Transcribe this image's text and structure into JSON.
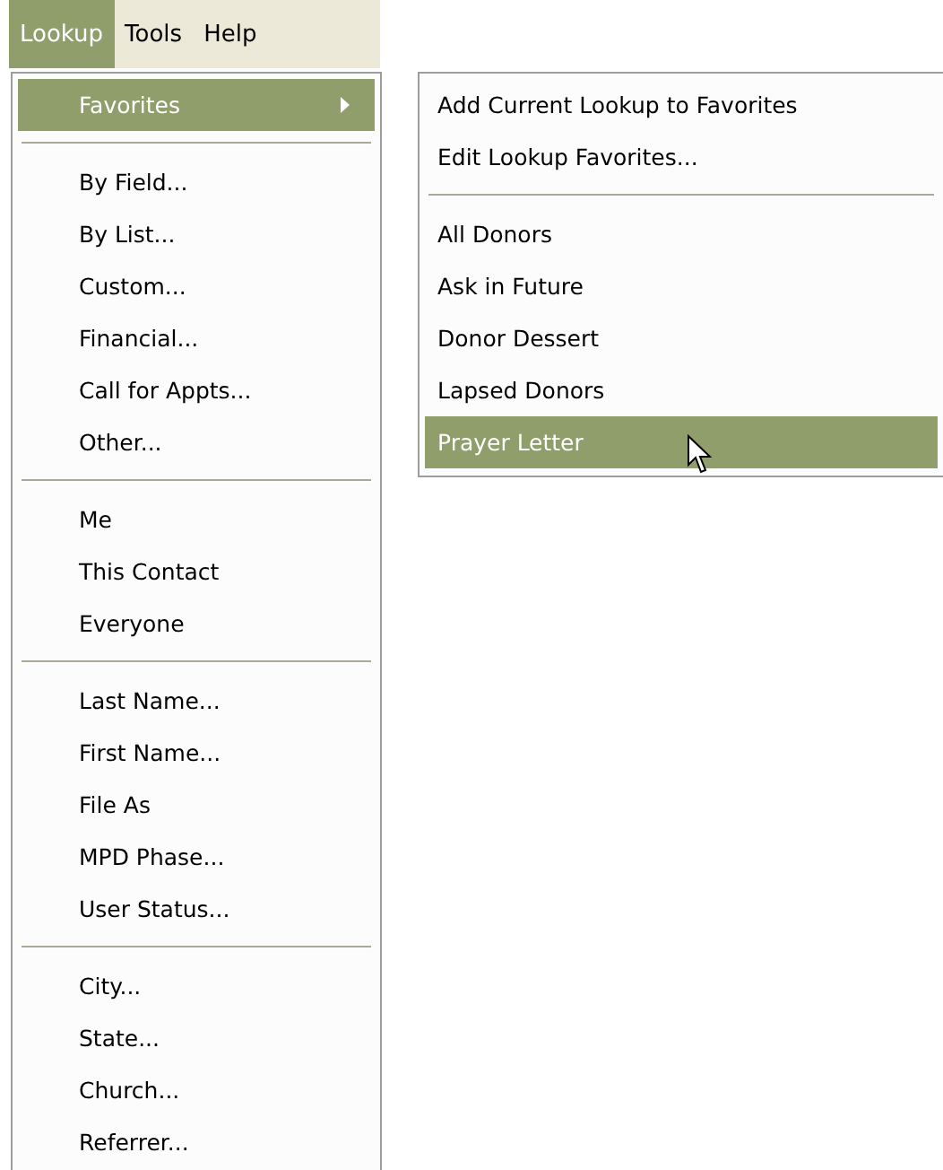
{
  "menu_bar": [
    {
      "label": "Lookup",
      "selected": true
    },
    {
      "label": "Tools",
      "selected": false
    },
    {
      "label": "Help",
      "selected": false
    }
  ],
  "lookup_menu": {
    "sections": [
      [
        {
          "label": "Favorites",
          "selected": true,
          "has_submenu": true
        }
      ],
      [
        {
          "label": "By Field...",
          "selected": false
        },
        {
          "label": "By List...",
          "selected": false
        },
        {
          "label": "Custom...",
          "selected": false
        },
        {
          "label": "Financial...",
          "selected": false
        },
        {
          "label": "Call for Appts...",
          "selected": false
        },
        {
          "label": "Other...",
          "selected": false
        }
      ],
      [
        {
          "label": "Me",
          "selected": false
        },
        {
          "label": "This Contact",
          "selected": false
        },
        {
          "label": "Everyone",
          "selected": false
        }
      ],
      [
        {
          "label": "Last Name...",
          "selected": false
        },
        {
          "label": "First Name...",
          "selected": false
        },
        {
          "label": "File As",
          "selected": false
        },
        {
          "label": "MPD Phase...",
          "selected": false
        },
        {
          "label": "User Status...",
          "selected": false
        }
      ],
      [
        {
          "label": "City...",
          "selected": false
        },
        {
          "label": "State...",
          "selected": false
        },
        {
          "label": "Church...",
          "selected": false
        },
        {
          "label": "Referrer...",
          "selected": false
        }
      ]
    ]
  },
  "favorites_submenu": {
    "sections": [
      [
        {
          "label": "Add Current Lookup to Favorites",
          "selected": false
        },
        {
          "label": "Edit Lookup Favorites...",
          "selected": false
        }
      ],
      [
        {
          "label": "All Donors",
          "selected": false
        },
        {
          "label": "Ask in Future",
          "selected": false
        },
        {
          "label": "Donor Dessert",
          "selected": false
        },
        {
          "label": "Lapsed Donors",
          "selected": false
        },
        {
          "label": "Prayer Letter",
          "selected": true
        }
      ]
    ]
  }
}
